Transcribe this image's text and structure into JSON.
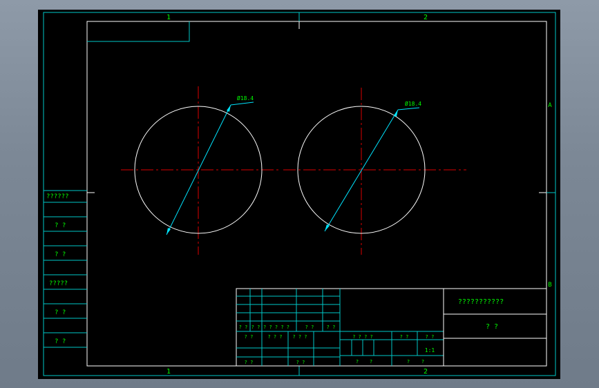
{
  "zone_labels": {
    "top": [
      "1",
      "2"
    ],
    "bottom": [
      "1",
      "2"
    ],
    "right": [
      "A",
      "B"
    ]
  },
  "dimensions": [
    {
      "label": "Ø18.4"
    },
    {
      "label": "Ø18.4"
    }
  ],
  "left_panel": {
    "labels": [
      "??????",
      "? ?",
      "? ?",
      "?????",
      "? ?",
      "? ?"
    ]
  },
  "title_block": {
    "sign_row": [
      "? ?",
      "? ?",
      "? ? ? ? ?",
      "? ?",
      "? ?"
    ],
    "row2": [
      "? ?",
      "? ? ?",
      "? ? ?"
    ],
    "row3": [
      "? ?",
      "? ?"
    ],
    "stage_headers": [
      "? ? ? ?",
      "? ?",
      "? ?"
    ],
    "scale": "1:1",
    "stage_bottom": [
      "?",
      "?",
      "?",
      "?"
    ],
    "drawing_title": "???????????",
    "part_name": "? ?"
  },
  "colors": {
    "frame": "#ffffff",
    "cyan": "#00c8c8",
    "green": "#00ff00",
    "center_line": "#dd0000",
    "dimension": "#00e5ff"
  }
}
